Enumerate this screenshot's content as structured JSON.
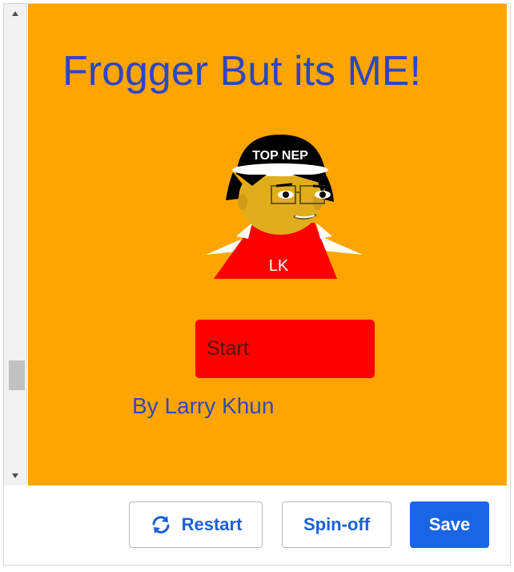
{
  "game": {
    "title": "Frogger But its ME!",
    "avatar": {
      "hat_text": "TOP NEP",
      "shirt_text": "LK"
    },
    "start_label": "Start",
    "author": "By Larry Khun",
    "colors": {
      "background": "#ffa500",
      "title": "#2e45c4",
      "start_button": "#ff0000"
    }
  },
  "scrollbar": {
    "up_icon": "triangle-up-icon",
    "down_icon": "triangle-down-icon"
  },
  "toolbar": {
    "restart_label": "Restart",
    "restart_icon": "refresh-icon",
    "spinoff_label": "Spin-off",
    "save_label": "Save",
    "accent": "#1a64e6"
  }
}
